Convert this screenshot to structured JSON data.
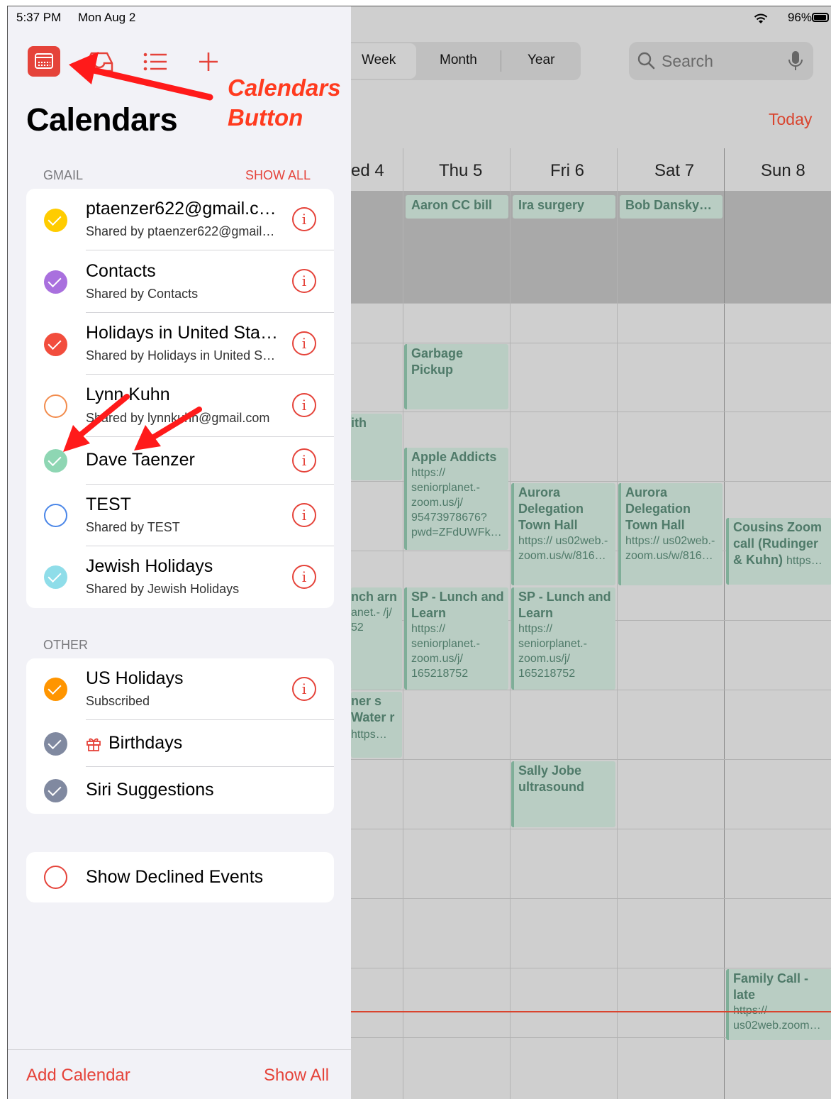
{
  "status": {
    "time": "5:37 PM",
    "date": "Mon Aug 2",
    "battery": "96%"
  },
  "view_switcher": {
    "items": [
      "Week",
      "Month",
      "Year"
    ],
    "selected": "Week"
  },
  "search": {
    "placeholder": "Search"
  },
  "today_label": "Today",
  "days": [
    "ed 4",
    "Thu 5",
    "Fri 6",
    "Sat 7",
    "Sun 8"
  ],
  "events": {
    "allday_thu": "Aaron CC bill",
    "allday_fri": "Ira surgery",
    "allday_sat": "Bob Dansky…",
    "garbage": "Garbage Pickup",
    "wed_partial1": "ith",
    "apple_title": "Apple Addicts",
    "apple_url": "https:// seniorplanet.-zoom.us/j/ 95473978676? pwd=ZFdUWFk…",
    "aurora_title": "Aurora Delegation Town Hall",
    "aurora_url": "https:// us02web.-zoom.us/w/816…",
    "cousins_title": "Cousins Zoom call (Rudinger & Kuhn)",
    "cousins_url": "https…",
    "sp_title": "SP - Lunch and Learn",
    "sp_url": "https:// seniorplanet.-zoom.us/j/ 165218752",
    "wed_partial2_title": "nch arn",
    "wed_partial2_url": "anet.- /j/ 52",
    "wed_partial3_title": "ner s Water r",
    "wed_partial3_url": "https…",
    "sally": "Sally Jobe ultrasound",
    "family_title": "Family Call - late",
    "family_url": "https:// us02web.zoom…"
  },
  "panel": {
    "title": "Calendars",
    "toolbar_icons": [
      "calendar-icon",
      "inbox-icon",
      "list-icon",
      "plus-icon"
    ],
    "gmail_header": "GMAIL",
    "gmail_show_all": "SHOW ALL",
    "gmail": [
      {
        "name": "ptaenzer622@gmail.c…",
        "sub": "Shared by ptaenzer622@gmail…",
        "color": "#ffcc00",
        "checked": true
      },
      {
        "name": "Contacts",
        "sub": "Shared by Contacts",
        "color": "#a970de",
        "checked": true
      },
      {
        "name": "Holidays in United Sta…",
        "sub": "Shared by Holidays in United S…",
        "color": "#f24d3d",
        "checked": true
      },
      {
        "name": "Lynn Kuhn",
        "sub": "Shared by lynnkuhn@gmail.com",
        "color": "#f28c4d",
        "checked": false
      },
      {
        "name": "Dave Taenzer",
        "sub": "",
        "color": "#8ed6b3",
        "checked": true
      },
      {
        "name": "TEST",
        "sub": "Shared by TEST",
        "color": "#4a86e8",
        "checked": false
      },
      {
        "name": "Jewish Holidays",
        "sub": "Shared by Jewish Holidays",
        "color": "#8fdde9",
        "checked": true
      }
    ],
    "other_header": "OTHER",
    "other": [
      {
        "name": "US Holidays",
        "sub": "Subscribed",
        "color": "#ff9500",
        "checked": true
      },
      {
        "name": "Birthdays",
        "sub": "",
        "color": "#8089a0",
        "checked": true
      },
      {
        "name": "Siri Suggestions",
        "sub": "",
        "color": "#8089a0",
        "checked": true
      }
    ],
    "declined": "Show Declined Events",
    "add_calendar": "Add Calendar",
    "show_all": "Show All"
  },
  "annotation": {
    "line1": "Calendars",
    "line2": "Button"
  },
  "colors": {
    "accent": "#e5433a",
    "annotation": "#ff3b1f",
    "event_bg": "#b9cdc3",
    "event_text": "#4f7a69"
  }
}
